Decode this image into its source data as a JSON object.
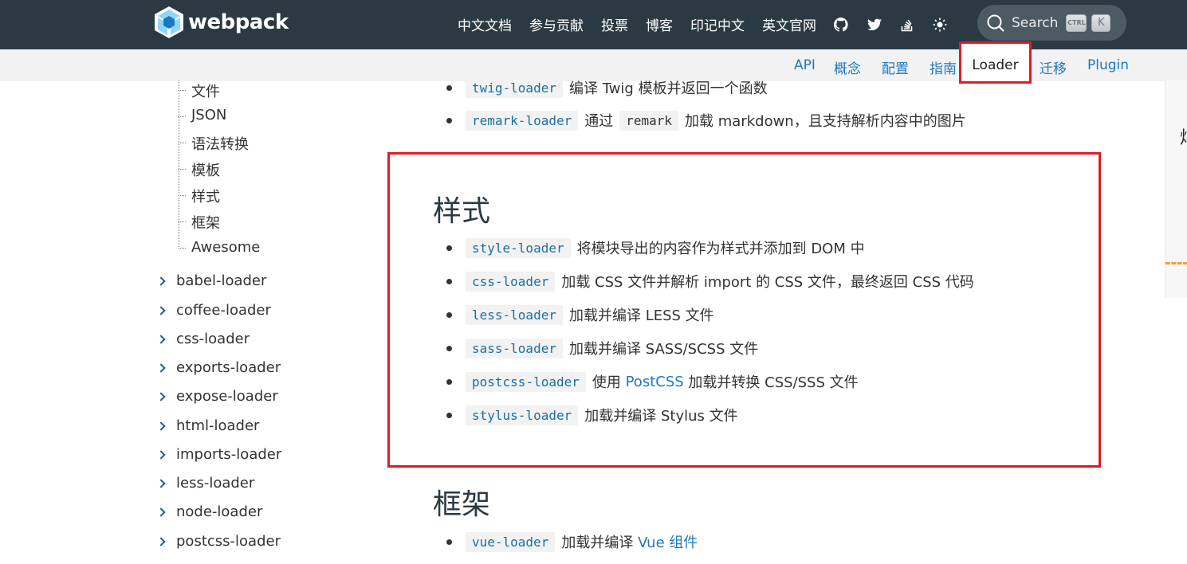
{
  "header": {
    "logo_text": "webpack",
    "nav": [
      "中文文档",
      "参与贡献",
      "投票",
      "博客",
      "印记中文",
      "英文官网"
    ],
    "icons": [
      "github-icon",
      "twitter-icon",
      "stackoverflow-icon",
      "theme-toggle-icon"
    ],
    "search": {
      "label": "Search",
      "kbd_ctrl": "CTRL",
      "kbd_k": "K"
    }
  },
  "subnav": {
    "items": [
      "API",
      "概念",
      "配置",
      "指南"
    ],
    "active": "Loader",
    "items_after": [
      "迁移",
      "Plugin"
    ]
  },
  "sidebar": {
    "tree_items": [
      "文件",
      "JSON",
      "语法转换",
      "模板",
      "样式",
      "框架",
      "Awesome"
    ],
    "loaders": [
      "babel-loader",
      "coffee-loader",
      "css-loader",
      "exports-loader",
      "expose-loader",
      "html-loader",
      "imports-loader",
      "less-loader",
      "node-loader",
      "postcss-loader"
    ]
  },
  "main": {
    "top_items": [
      {
        "code": "twig-loader",
        "text": "编译 Twig 模板并返回一个函数"
      },
      {
        "code": "remark-loader",
        "pre": "通过",
        "code2": "remark",
        "text": "加载 markdown，且支持解析内容中的图片"
      }
    ],
    "styles_heading": "样式",
    "styles_items": [
      {
        "code": "style-loader",
        "text": "将模块导出的内容作为样式并添加到 DOM 中"
      },
      {
        "code": "css-loader",
        "text": "加载 CSS 文件并解析 import 的 CSS 文件，最终返回 CSS 代码"
      },
      {
        "code": "less-loader",
        "text": "加载并编译 LESS 文件"
      },
      {
        "code": "sass-loader",
        "text": "加载并编译 SASS/SCSS 文件"
      },
      {
        "code": "postcss-loader",
        "pre": "使用",
        "link": "PostCSS",
        "text": "加载并转换 CSS/SSS 文件"
      },
      {
        "code": "stylus-loader",
        "text": "加载并编译 Stylus 文件"
      }
    ],
    "frameworks_heading": "框架",
    "frameworks_items": [
      {
        "code": "vue-loader",
        "text": "加载并编译",
        "link": "Vue 组件"
      }
    ]
  },
  "ad": {
    "partial_glyph": "炫"
  },
  "colors": {
    "topbar": "#2b3a42",
    "link": "#1d78c1",
    "highlight": "#e01b24"
  }
}
